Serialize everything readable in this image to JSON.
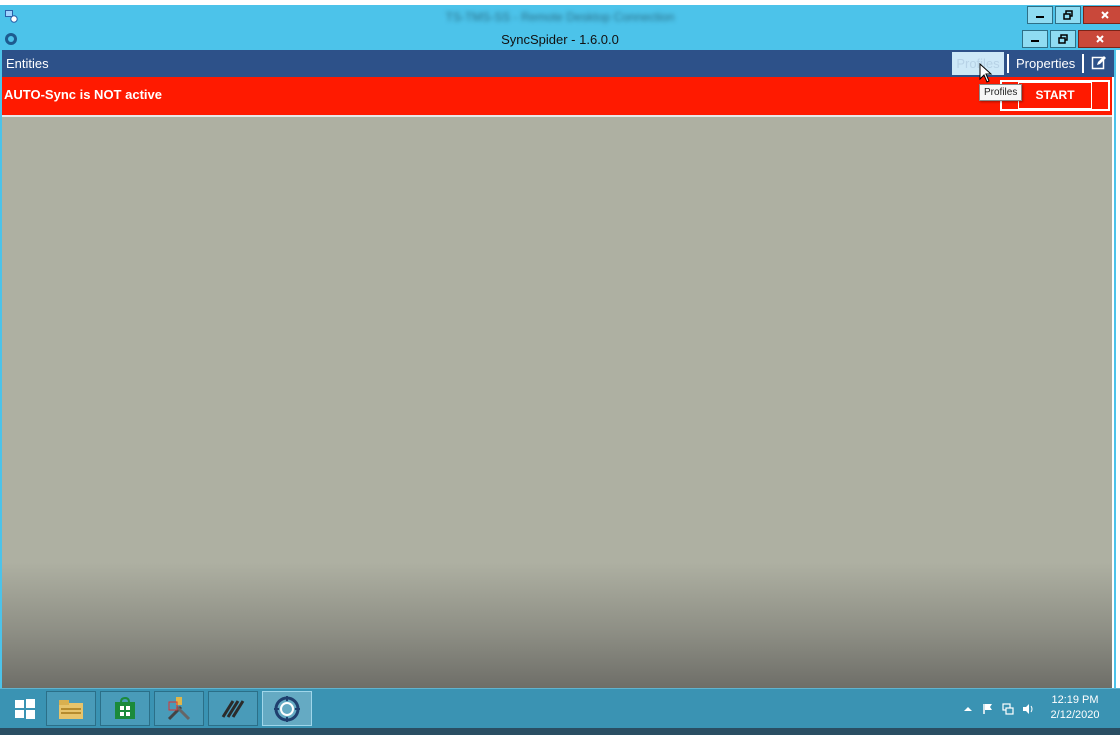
{
  "rdp_window": {
    "title": "TS-TMS-SS - Remote Desktop Connection"
  },
  "app_window": {
    "title": "SyncSpider - 1.6.0.0"
  },
  "menubar": {
    "entities_label": "Entities",
    "profiles_label": "Profiles",
    "properties_label": "Properties",
    "edit_icon": "edit-icon"
  },
  "status": {
    "message": "AUTO-Sync is NOT active",
    "start_label": "START",
    "bar_color": "#ff1a00"
  },
  "tooltip": {
    "text": "Profiles"
  },
  "taskbar": {
    "buttons": [
      {
        "icon": "windows-start-icon"
      },
      {
        "icon": "file-explorer-icon"
      },
      {
        "icon": "store-icon"
      },
      {
        "icon": "server-tools-icon"
      },
      {
        "icon": "sync-app-icon"
      },
      {
        "icon": "syncspider-icon"
      }
    ],
    "tray_icons": [
      "show-hidden-icons-icon",
      "flag-icon",
      "network-icon",
      "volume-icon"
    ],
    "time": "12:19 PM",
    "date": "2/12/2020"
  },
  "colors": {
    "titlebar": "#4cc3ea",
    "menubar": "#2d5189",
    "content": "#aeb0a2",
    "taskbar": "#3a93b3"
  }
}
